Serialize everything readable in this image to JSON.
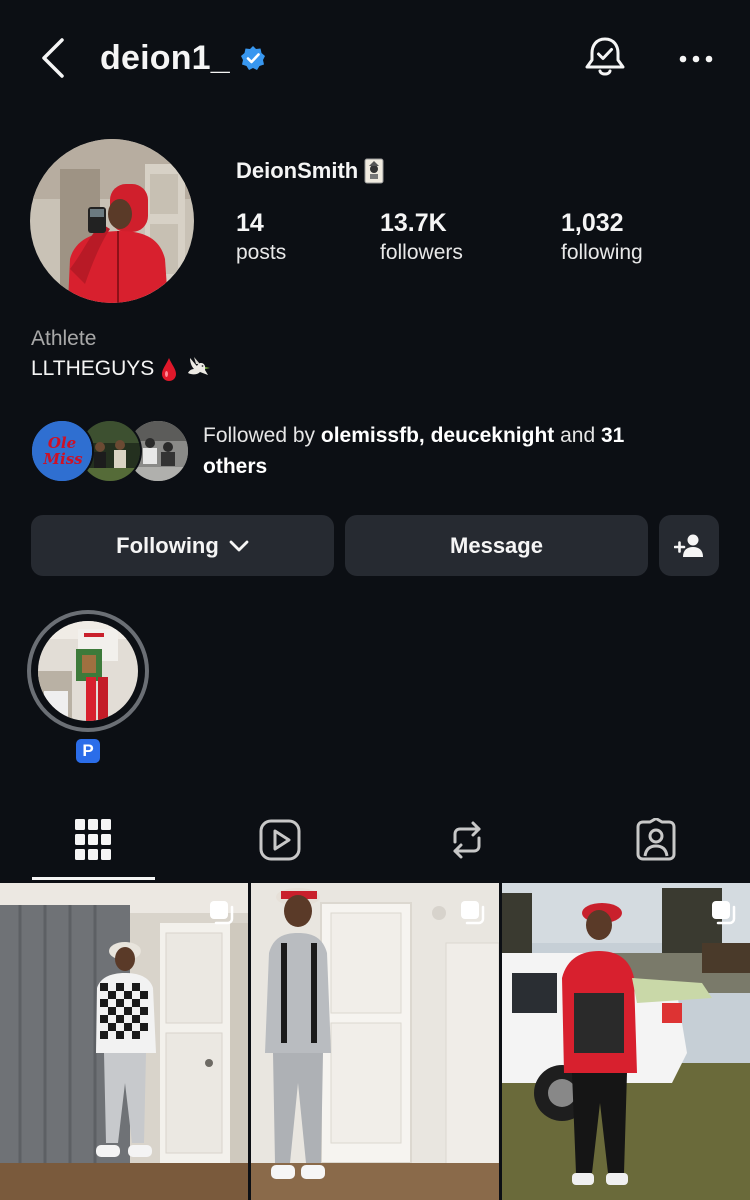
{
  "header": {
    "username": "deion1_"
  },
  "profile": {
    "display_name": "DeionSmith",
    "stats": {
      "posts": {
        "value": "14",
        "label": "posts"
      },
      "followers": {
        "value": "13.7K",
        "label": "followers"
      },
      "following": {
        "value": "1,032",
        "label": "following"
      }
    },
    "category": "Athlete",
    "bio": "LLTHEGUYS",
    "bio_emojis": [
      "drop-of-blood",
      "dove"
    ]
  },
  "followed_by": {
    "prefix": "Followed by ",
    "names": "olemissfb, deuceknight",
    "middle": " and ",
    "count": "31",
    "suffix": "others",
    "logo_text": "Ole Miss"
  },
  "actions": {
    "following_label": "Following",
    "message_label": "Message"
  },
  "highlights": [
    {
      "label": "P"
    }
  ],
  "tabs": [
    "grid",
    "reels",
    "reposts",
    "tagged"
  ],
  "colors": {
    "background": "#0c0f14",
    "button": "#262a31",
    "verified": "#3897f0",
    "highlight_badge": "#2b6de9"
  }
}
